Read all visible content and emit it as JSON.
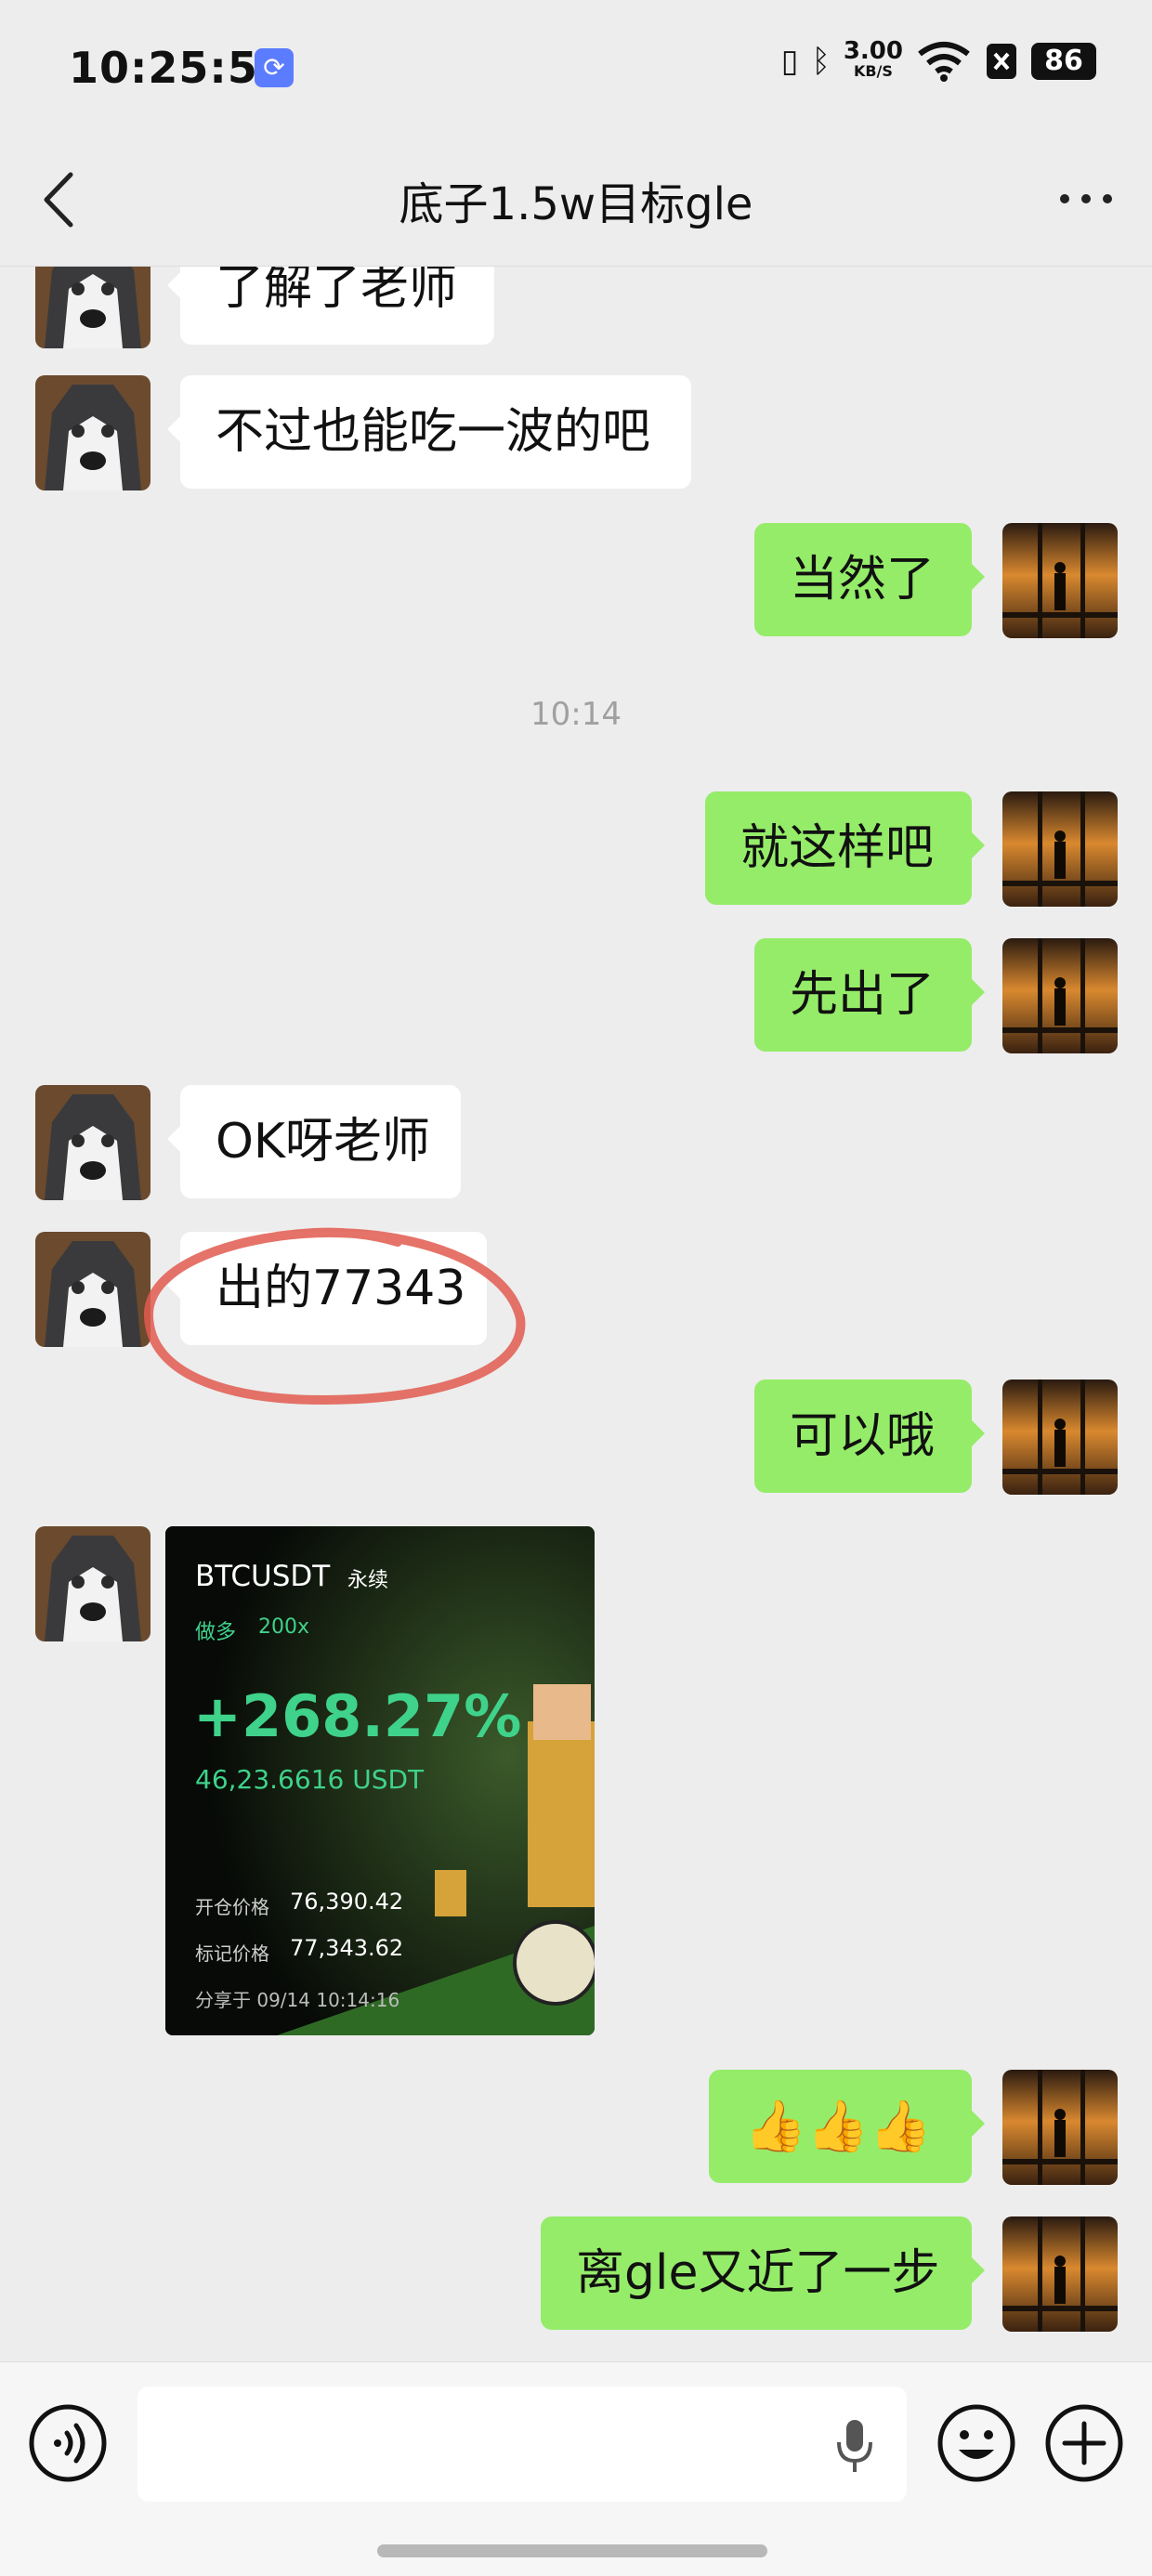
{
  "status_bar": {
    "time": "10:25:54",
    "speed_value": "3.00",
    "speed_unit": "KB/S",
    "battery": "86"
  },
  "header": {
    "title": "底子1.5w目标gle"
  },
  "messages": {
    "m1": "了解了老师",
    "m2": "不过也能吃一波的吧",
    "m3": "当然了",
    "time1": "10:14",
    "m4": "就这样吧",
    "m5": "先出了",
    "m6": "OK呀老师",
    "m7": "出的77343",
    "m8": "可以哦",
    "m10": "👍👍👍",
    "m11": "离gle又近了一步"
  },
  "trade_card": {
    "pair": "BTCUSDT",
    "type": "永续",
    "side": "做多",
    "leverage": "200x",
    "pnl_percent": "+268.27%",
    "pnl_amount": "46,23.6616 USDT",
    "open_label": "开仓价格",
    "open_price": "76,390.42",
    "mark_label": "标记价格",
    "mark_price": "77,343.62",
    "shared": "分享于 09/14 10:14:16"
  },
  "colors": {
    "accent_green": "#95ec69",
    "profit_green": "#3fd28a",
    "circle_red": "#e05a4f"
  },
  "icons": [
    "back-icon",
    "more-icon",
    "voice-icon",
    "mic-icon",
    "emoji-icon",
    "plus-icon"
  ]
}
